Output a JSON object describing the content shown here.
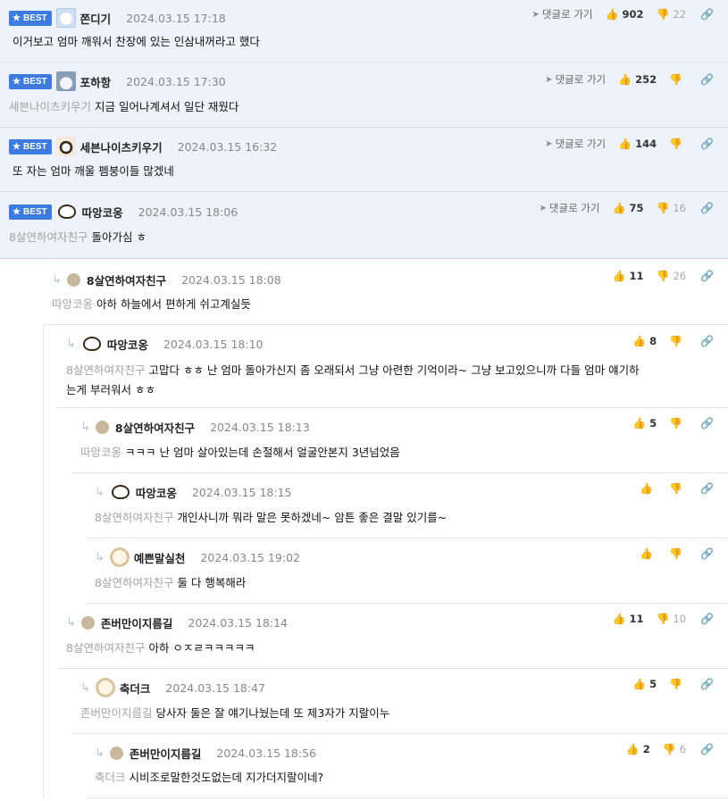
{
  "best_label": "BEST",
  "goto_label": "댓글로 가기",
  "best_comments": [
    {
      "nick": "쫀디기",
      "time": "2024.03.15 17:18",
      "up": "902",
      "down": "22",
      "mention": "",
      "text": "이거보고 엄마 깨워서 찬장에 있는 인삼내꺼라고 했다",
      "avatar": "bear-icon"
    },
    {
      "nick": "포하항",
      "time": "2024.03.15 17:30",
      "up": "252",
      "down": "",
      "mention": "세븐나이츠키우기",
      "text": "지금 일어나계셔서 일단 재웠다",
      "avatar": "cat-icon"
    },
    {
      "nick": "세븐나이츠키우기",
      "time": "2024.03.15 16:32",
      "up": "144",
      "down": "",
      "mention": "",
      "text": "또 자는 엄마 깨울 펨붕이들 많겠네",
      "avatar": "dog-icon"
    },
    {
      "nick": "따앙코옹",
      "time": "2024.03.15 18:06",
      "up": "75",
      "down": "16",
      "mention": "8살연하여자친구",
      "text": "돌아가심 ㅎ",
      "avatar": "fox-icon"
    }
  ],
  "replies": [
    {
      "nick": "8살연하여자친구",
      "time": "2024.03.15 18:08",
      "up": "11",
      "down": "26",
      "mention": "따앙코옹",
      "text": "아하 하늘에서 편하게 쉬고계실듯",
      "avatar": "dot"
    },
    {
      "nick": "따앙코옹",
      "time": "2024.03.15 18:10",
      "up": "8",
      "down": "",
      "mention": "8살연하여자친구",
      "text": "고맙다 ㅎㅎ 난 엄마 돌아가신지 좀 오래되서 그냥 아련한 기억이라~ 그냥 보고있으니까 다들 엄마 얘기하",
      "text2": "는게 부러워서 ㅎㅎ",
      "avatar": "fox-icon"
    },
    {
      "nick": "8살연하여자친구",
      "time": "2024.03.15 18:13",
      "up": "5",
      "down": "",
      "mention": "따앙코옹",
      "text": "ㅋㅋㅋ 난 엄마 살아있는데 손절해서 얼굴안본지 3년넘었음",
      "avatar": "dot"
    },
    {
      "nick": "따앙코옹",
      "time": "2024.03.15 18:15",
      "up": "",
      "down": "",
      "mention": "8살연하여자친구",
      "text": "개인사니까 뭐라 말은 못하겠네~ 암튼 좋은 결말 있기를~",
      "avatar": "fox-icon"
    },
    {
      "nick": "예쁜말실천",
      "time": "2024.03.15 19:02",
      "up": "",
      "down": "",
      "mention": "8살연하여자친구",
      "text": "둘 다 행복해라",
      "avatar": "puppy-icon"
    },
    {
      "nick": "존버만이지름길",
      "time": "2024.03.15 18:14",
      "up": "11",
      "down": "10",
      "mention": "8살연하여자친구",
      "text": "아하 ㅇㅈㄹㅋㅋㅋㅋㅋ",
      "avatar": "dot"
    },
    {
      "nick": "축더크",
      "time": "2024.03.15 18:47",
      "up": "5",
      "down": "",
      "mention": "존버만이지름길",
      "text": "당사자 둘은 잘 얘기나눴는데 또 제3자가 지랄이누",
      "avatar": "puppy-icon"
    },
    {
      "nick": "존버만이지름길",
      "time": "2024.03.15 18:56",
      "up": "2",
      "down": "6",
      "mention": "축더크",
      "text": "시비조로말한것도없는데 지가더지랄이네?",
      "avatar": "dot"
    }
  ]
}
